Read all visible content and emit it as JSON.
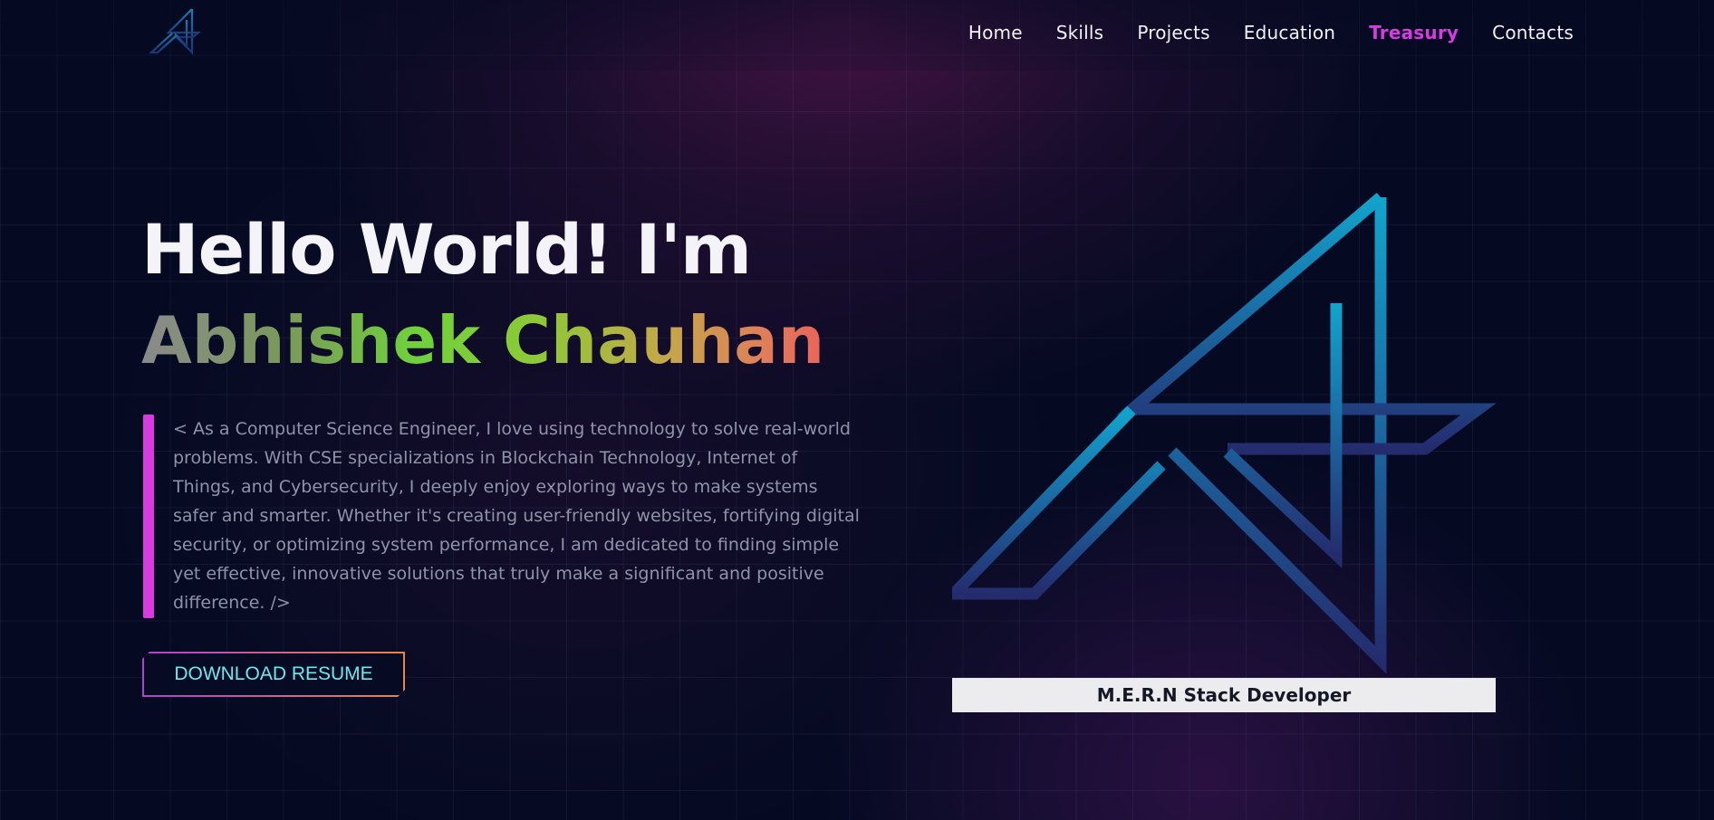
{
  "nav": {
    "items": [
      {
        "label": "Home",
        "active": false
      },
      {
        "label": "Skills",
        "active": false
      },
      {
        "label": "Projects",
        "active": false
      },
      {
        "label": "Education",
        "active": false
      },
      {
        "label": "Treasury",
        "active": true
      },
      {
        "label": "Contacts",
        "active": false
      }
    ],
    "active_color": "#d83be0"
  },
  "hero": {
    "greeting": "Hello World! I'm",
    "name": "Abhishek Chauhan",
    "bio": "< As a Computer Science Engineer, I love using technology to solve real-world problems. With CSE specializations in Blockchain Technology, Internet of Things, and Cybersecurity, I deeply enjoy exploring ways to make systems safer and smarter. Whether it's creating user-friendly websites, fortifying digital security, or optimizing system performance, I am dedicated to finding simple yet effective, innovative solutions that truly make a significant and positive difference. />",
    "resume_button": "DOWNLOAD RESUME",
    "role": "M.E.R.N Stack Developer"
  },
  "icons": {
    "logo": "a-monogram-logo-icon"
  },
  "colors": {
    "background": "#050a22",
    "accent": "#d83be0",
    "button_text": "#6fe7ef",
    "logo_gradient_top": "#14a0c8",
    "logo_gradient_bottom": "#26307a"
  }
}
